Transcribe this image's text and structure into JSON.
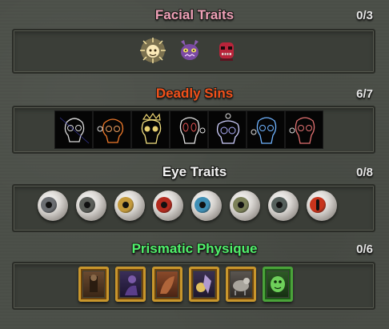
{
  "sections": [
    {
      "title": "Facial Traits",
      "color": "#ee9fb6",
      "count": "0/3",
      "items": [
        "glowing-cat-face-icon",
        "purple-imp-face-icon",
        "red-skull-mask-icon"
      ]
    },
    {
      "title": "Deadly Sins",
      "color": "#f0501a",
      "count": "6/7",
      "items": [
        "skull-sin-1",
        "skull-sin-2",
        "skull-sin-3",
        "skull-sin-4",
        "skull-sin-5",
        "skull-sin-6",
        "skull-sin-7"
      ]
    },
    {
      "title": "Eye Traits",
      "color": "#f2f2f2",
      "count": "0/8",
      "eyes": [
        {
          "name": "grey-eye",
          "iris": "#6b6e72"
        },
        {
          "name": "dark-grey-eye",
          "iris": "#5a5d58"
        },
        {
          "name": "golden-eye",
          "iris": "#c49a3b"
        },
        {
          "name": "red-eye",
          "iris": "#b32a1e"
        },
        {
          "name": "blue-eye",
          "iris": "#3f8fb5"
        },
        {
          "name": "olive-eye",
          "iris": "#7c8158"
        },
        {
          "name": "slate-eye",
          "iris": "#55605c"
        },
        {
          "name": "red-slit-eye",
          "iris": "#c8341c"
        }
      ]
    },
    {
      "title": "Prismatic Physique",
      "color": "#4ff06a",
      "count": "0/6",
      "items": [
        "portrait-brown-figure",
        "portrait-purple-figure",
        "portrait-rust-figure",
        "portrait-gold-figure",
        "portrait-grey-beast",
        "portrait-green-creature"
      ]
    }
  ]
}
